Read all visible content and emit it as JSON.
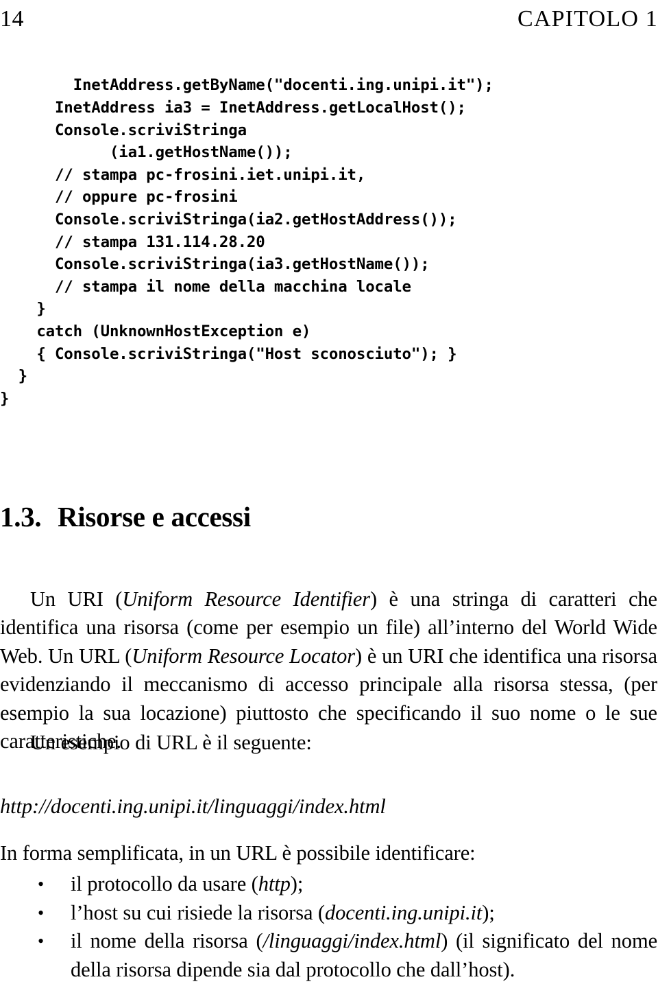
{
  "header": {
    "folio": "14",
    "chapter": "CAPITOLO 1"
  },
  "code_listing": {
    "language": "java-like pseudocode",
    "lines": [
      "        InetAddress.getByName(\"docenti.ing.unipi.it\");",
      "      InetAddress ia3 = InetAddress.getLocalHost();",
      "      Console.scriviStringa",
      "            (ia1.getHostName());",
      "      // stampa pc-frosini.iet.unipi.it,",
      "      // oppure pc-frosini",
      "      Console.scriviStringa(ia2.getHostAddress());",
      "      // stampa 131.114.28.20",
      "      Console.scriviStringa(ia3.getHostName());",
      "      // stampa il nome della macchina locale",
      "    }",
      "    catch (UnknownHostException e)",
      "    { Console.scriviStringa(\"Host sconosciuto\"); }",
      "  }",
      "}"
    ]
  },
  "section": {
    "number": "1.3.",
    "title": "Risorse e accessi"
  },
  "paragraphs": {
    "p1_part1": "Un URI (",
    "p1_italic1": "Uniform Resource Identifier",
    "p1_part2": ") è una stringa di caratteri che identifica una risorsa (come per esempio un file) all’interno del World Wide Web. Un URL (",
    "p1_italic2": "Uniform Resource Locator",
    "p1_part3": ") è un URI che identifica una risorsa evidenziando il meccanismo di accesso principale alla risorsa stessa, (per esempio la sua locazione) piuttosto che specificando il suo nome o le sue caratteristiche.",
    "p2": "Un esempio di URL è il seguente:",
    "url_example": "http://docenti.ing.unipi.it/linguaggi/index.html",
    "p3": "In forma semplificata, in un URL è possibile identificare:"
  },
  "bullets": [
    {
      "glyph": "•",
      "text_before": "il protocollo da usare (",
      "italic": "http",
      "text_after": ");"
    },
    {
      "glyph": "•",
      "text_before": "l’host su cui risiede la risorsa (",
      "italic": "docenti.ing.unipi.it",
      "text_after": ");"
    },
    {
      "glyph": "•",
      "text_before": "il nome della risorsa (",
      "italic": "/linguaggi/index.html",
      "text_after": ") (il significato del nome della risorsa dipende sia dal protocollo che dall’host)."
    }
  ],
  "colors": {
    "page_background": "#ffffff",
    "text": "#000000"
  }
}
